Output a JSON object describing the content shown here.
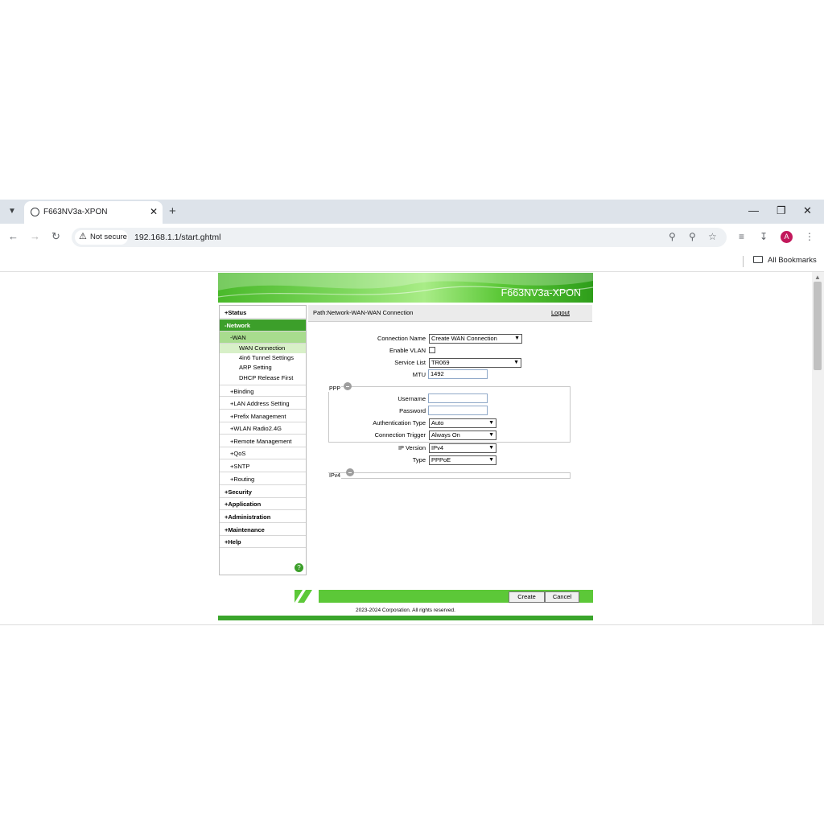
{
  "browser": {
    "tab_title": "F663NV3a-XPON",
    "url": "192.168.1.1/start.ghtml",
    "not_secure": "Not secure",
    "all_bookmarks": "All Bookmarks",
    "avatar_letter": "A"
  },
  "banner": {
    "title": "F663NV3a-XPON"
  },
  "menu": {
    "status": "+Status",
    "network": "-Network",
    "wan": "-WAN",
    "wan_connection": "WAN Connection",
    "tunnel": "4in6 Tunnel Settings",
    "arp": "ARP Setting",
    "dhcp": "DHCP Release First",
    "binding": "+Binding",
    "lan": "+LAN Address Setting",
    "prefix": "+Prefix Management",
    "wlan": "+WLAN Radio2.4G",
    "remote": "+Remote Management",
    "qos": "+QoS",
    "sntp": "+SNTP",
    "routing": "+Routing",
    "security": "+Security",
    "application": "+Application",
    "administration": "+Administration",
    "maintenance": "+Maintenance",
    "help": "+Help",
    "help_icon": "?"
  },
  "path": {
    "text": "Path:Network-WAN-WAN Connection",
    "logout": "Logout"
  },
  "form": {
    "connection_name_label": "Connection Name",
    "connection_name_value": "Create WAN Connection",
    "enable_vlan_label": "Enable VLAN",
    "service_list_label": "Service List",
    "service_list_value": "TR069",
    "mtu_label": "MTU",
    "mtu_value": "1492",
    "ppp_legend": "PPP",
    "username_label": "Username",
    "username_value": "",
    "password_label": "Password",
    "password_value": "",
    "auth_type_label": "Authentication Type",
    "auth_type_value": "Auto",
    "conn_trigger_label": "Connection Trigger",
    "conn_trigger_value": "Always On",
    "ip_version_label": "IP Version",
    "ip_version_value": "IPv4",
    "type_label": "Type",
    "type_value": "PPPoE",
    "ipv4_legend": "IPv4"
  },
  "buttons": {
    "create": "Create",
    "cancel": "Cancel"
  },
  "footer": {
    "copyright": "2023-2024 Corporation. All rights reserved."
  },
  "colors": {
    "accent_green": "#3c9f2a",
    "tab_strip": "#dde3ea"
  }
}
